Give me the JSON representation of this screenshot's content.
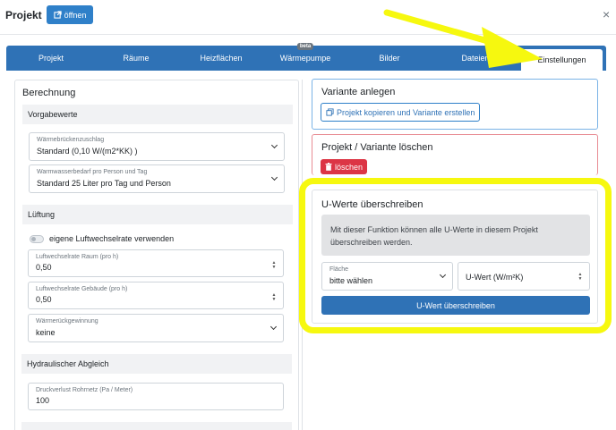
{
  "header": {
    "title": "Projekt",
    "open_label": "öffnen",
    "close_symbol": "×"
  },
  "tabs": [
    {
      "label": "Projekt",
      "active": false
    },
    {
      "label": "Räume",
      "active": false
    },
    {
      "label": "Heizflächen",
      "active": false
    },
    {
      "label": "Wärmepumpe",
      "active": false,
      "badge": "beta"
    },
    {
      "label": "Bilder",
      "active": false
    },
    {
      "label": "Dateien",
      "active": false
    },
    {
      "label": "Einstellungen",
      "active": true
    }
  ],
  "left": {
    "title": "Berechnung",
    "sections": {
      "vorgabewerte": "Vorgabewerte",
      "lueftung": "Lüftung",
      "hydraulik": "Hydraulischer Abgleich"
    },
    "fields": {
      "waermebruecken": {
        "label": "Wärmebrückenzuschlag",
        "value": "Standard (0,10 W/(m2*KK) )"
      },
      "warmwasser": {
        "label": "Warmwasserbedarf pro Person und Tag",
        "value": "Standard 25 Liter pro Tag und Person"
      },
      "luftwechsel_raum": {
        "label": "Luftwechselrate Raum (pro h)",
        "value": "0,50"
      },
      "luftwechsel_gebaeude": {
        "label": "Luftwechselrate Gebäude (pro h)",
        "value": "0,50"
      },
      "waermerueck": {
        "label": "Wärmerückgewinnung",
        "value": "keine"
      },
      "druckverlust": {
        "label": "Druckverlust Rohrnetz (Pa / Meter)",
        "value": "100"
      }
    },
    "toggle_label": "eigene Luftwechselrate verwenden",
    "toggle_on": false
  },
  "right": {
    "variant": {
      "title": "Variante anlegen",
      "button": "Projekt kopieren und Variante erstellen"
    },
    "delete": {
      "title": "Projekt / Variante löschen",
      "button": "löschen"
    },
    "uwerte": {
      "title": "U-Werte überschreiben",
      "info": "Mit dieser Funktion können alle U-Werte in diesem Projekt überschreiben werden.",
      "flaeche_label": "Fläche",
      "flaeche_value": "bitte wählen",
      "uwert_placeholder": "U-Wert (W/m²K)",
      "button": "U-Wert überschreiben"
    }
  },
  "colors": {
    "primary": "#2f72b6",
    "danger": "#dc3545",
    "highlight": "#f6f80f"
  },
  "icons": [
    "external-link-icon",
    "close-icon",
    "copy-icon",
    "trash-icon",
    "chevron-down-icon",
    "spinner-icon",
    "arrow-annotation-icon"
  ]
}
